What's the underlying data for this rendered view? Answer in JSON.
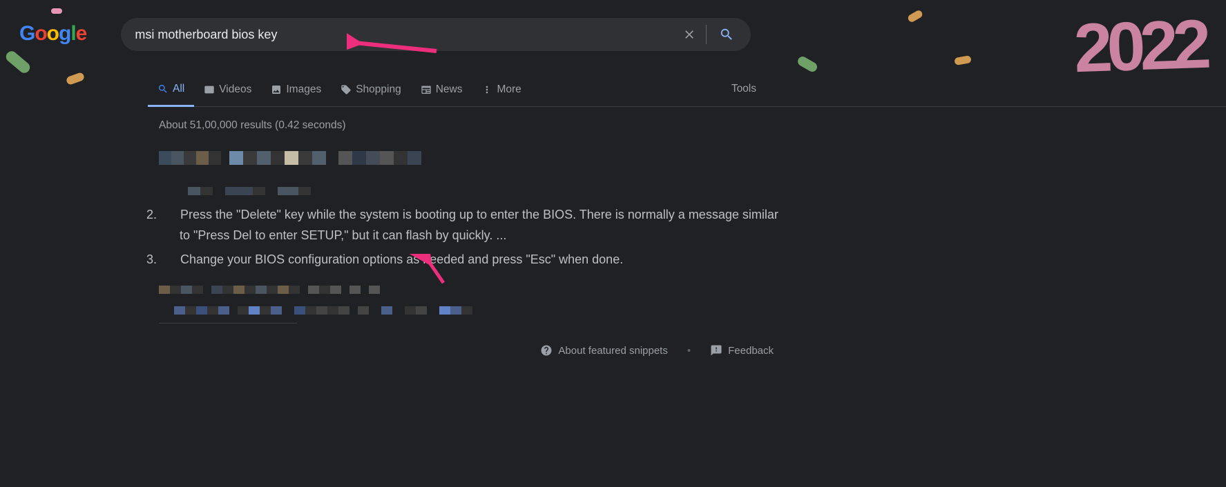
{
  "logo": {
    "text": "Google"
  },
  "search": {
    "query": "msi motherboard bios key"
  },
  "tabs": {
    "all": "All",
    "videos": "Videos",
    "images": "Images",
    "shopping": "Shopping",
    "news": "News",
    "more": "More",
    "tools": "Tools"
  },
  "result_stats": "About 51,00,000 results (0.42 seconds)",
  "snippet": {
    "item2_num": "2.",
    "item2": "Press the \"Delete\" key while the system is booting up to enter the BIOS. There is normally a message similar to \"Press Del to enter SETUP,\" but it can flash by quickly. ...",
    "item3_num": "3.",
    "item3": "Change your BIOS configuration options as needed and press \"Esc\" when done."
  },
  "footer": {
    "about": "About featured snippets",
    "feedback": "Feedback"
  },
  "decoration": {
    "year": "2022"
  }
}
